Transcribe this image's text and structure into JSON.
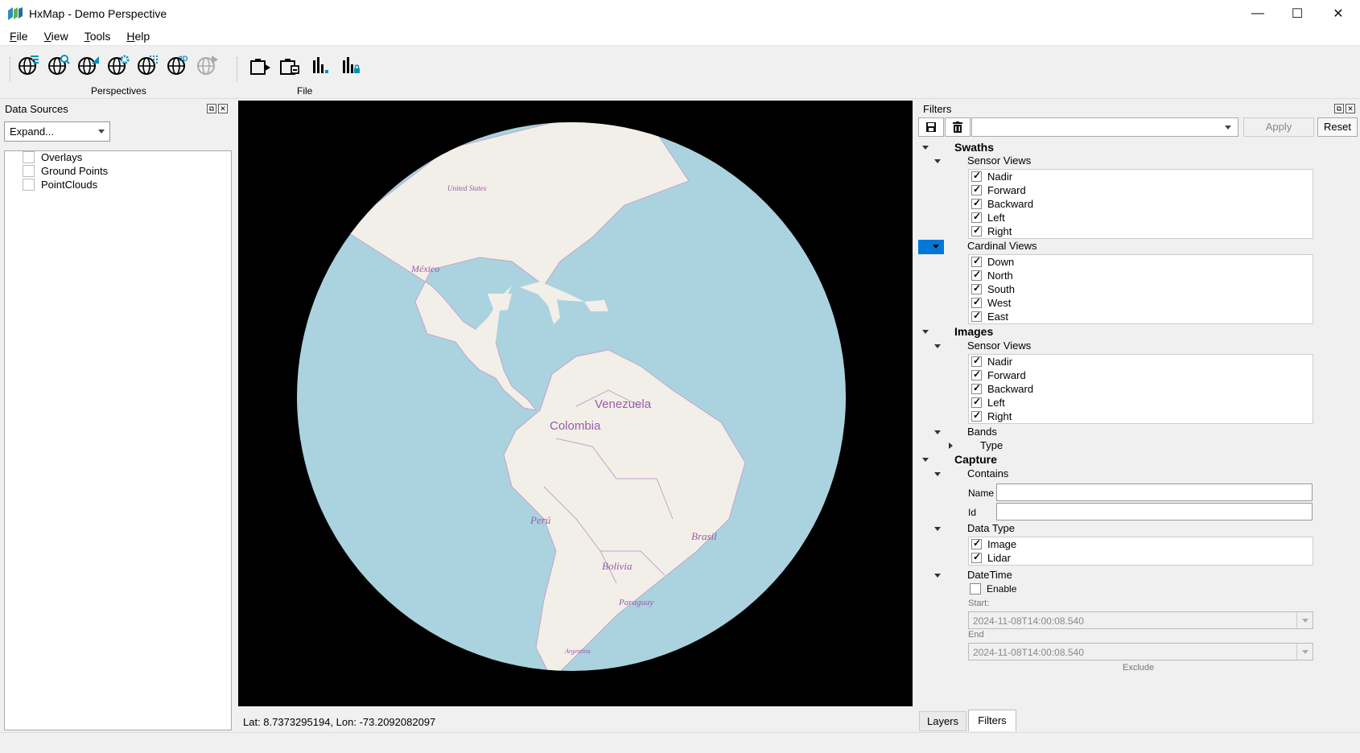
{
  "window": {
    "title": "HxMap - Demo Perspective",
    "controls": {
      "minimize": "—",
      "maximize": "☐",
      "close": "✕"
    }
  },
  "menu": [
    {
      "label": "File",
      "accel": "F",
      "rest": "ile"
    },
    {
      "label": "View",
      "accel": "V",
      "rest": "iew"
    },
    {
      "label": "Tools",
      "accel": "T",
      "rest": "ools"
    },
    {
      "label": "Help",
      "accel": "H",
      "rest": "elp"
    }
  ],
  "toolbar": {
    "groups": [
      {
        "label": "Perspectives",
        "icons": [
          "globe-filter-icon",
          "globe-search-icon",
          "globe-measure-icon",
          "globe-settings-icon",
          "globe-grid-icon",
          "globe-3d-icon",
          "globe-play-icon"
        ]
      },
      {
        "label": "File",
        "icons": [
          "export-icon",
          "import-icon",
          "chart-icon",
          "chart-lock-icon"
        ]
      }
    ]
  },
  "data_sources": {
    "title": "Data Sources",
    "expand_select": "Expand...",
    "items": [
      {
        "label": "Overlays",
        "checked": false
      },
      {
        "label": "Ground Points",
        "checked": false
      },
      {
        "label": "PointClouds",
        "checked": false
      }
    ]
  },
  "map": {
    "labels": {
      "united_states": "United States",
      "mexico": "México",
      "venezuela": "Venezuela",
      "colombia": "Colombia",
      "peru": "Perú",
      "brasil": "Brasil",
      "bolivia": "Bolivia",
      "paraguay": "Paraguay",
      "argentina": "Argentina"
    },
    "coordinates": "Lat: 8.7373295194, Lon: -73.2092082097",
    "colors": {
      "ocean": "#aad3df",
      "land": "#f2efe9",
      "border": "#c3a4c9",
      "label": "#9a5ca6",
      "background": "#000000"
    }
  },
  "filters": {
    "title": "Filters",
    "apply_label": "Apply",
    "reset_label": "Reset",
    "swaths": {
      "label": "Swaths",
      "sensor_views": {
        "label": "Sensor Views",
        "items": [
          "Nadir",
          "Forward",
          "Backward",
          "Left",
          "Right"
        ]
      },
      "cardinal_views": {
        "label": "Cardinal Views",
        "items": [
          "Down",
          "North",
          "South",
          "West",
          "East"
        ]
      }
    },
    "images": {
      "label": "Images",
      "sensor_views": {
        "label": "Sensor Views",
        "items": [
          "Nadir",
          "Forward",
          "Backward",
          "Left",
          "Right"
        ]
      },
      "bands": {
        "label": "Bands",
        "type_label": "Type"
      }
    },
    "capture": {
      "label": "Capture",
      "contains": {
        "label": "Contains",
        "name_label": "Name",
        "id_label": "Id",
        "name_value": "",
        "id_value": ""
      },
      "data_type": {
        "label": "Data Type",
        "items": [
          "Image",
          "Lidar"
        ]
      },
      "datetime": {
        "label": "DateTime",
        "enable_label": "Enable",
        "enabled": false,
        "start_label": "Start:",
        "start_value": "2024-11-08T14:00:08.540",
        "end_label": "End",
        "end_value": "2024-11-08T14:00:08.540",
        "exclude_label": "Exclude"
      }
    }
  },
  "tabs": {
    "layers": "Layers",
    "filters": "Filters",
    "active": "Filters"
  }
}
